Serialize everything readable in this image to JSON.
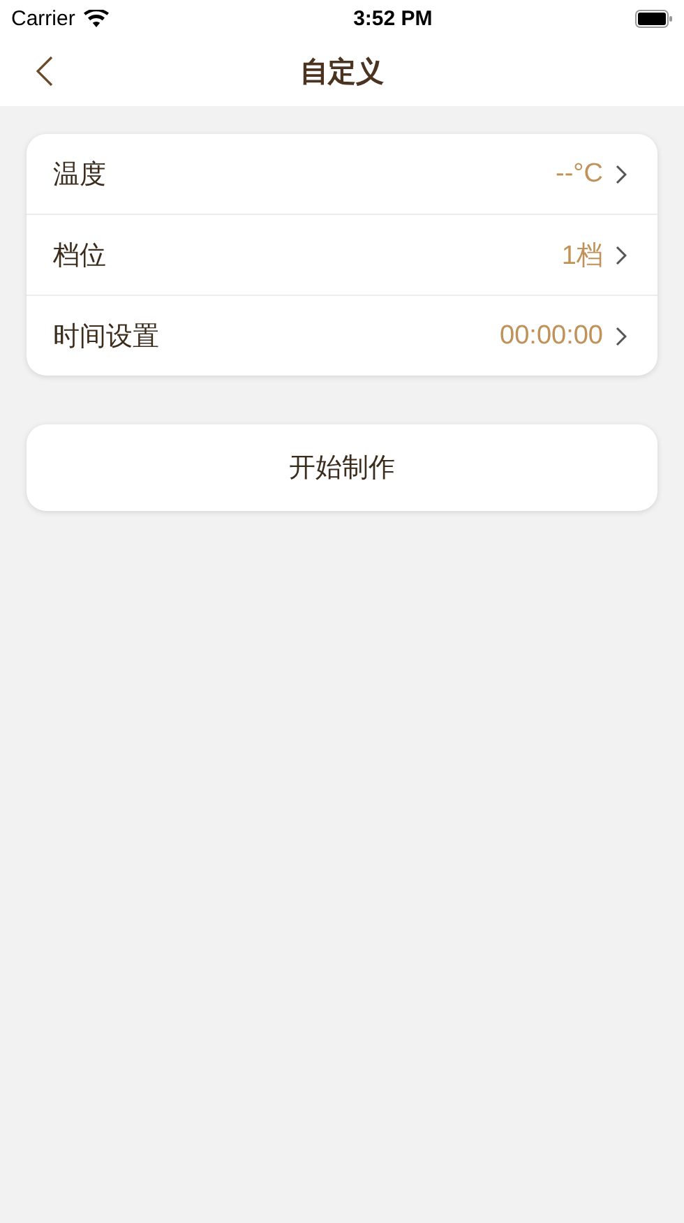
{
  "status_bar": {
    "carrier": "Carrier",
    "time": "3:52 PM"
  },
  "nav": {
    "title": "自定义"
  },
  "settings": [
    {
      "label": "温度",
      "value": "--°C"
    },
    {
      "label": "档位",
      "value": "1档"
    },
    {
      "label": "时间设置",
      "value": "00:00:00"
    }
  ],
  "start_button": "开始制作"
}
